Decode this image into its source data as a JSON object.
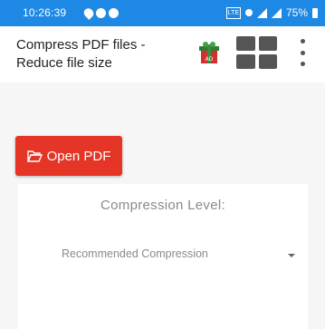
{
  "status_bar": {
    "time": "10:26:39",
    "sim_label": "LTE",
    "battery": "75%",
    "color": "#1e88e5"
  },
  "app_bar": {
    "title": "Compress PDF files - Reduce file size",
    "gift_badge": "AD",
    "icons": [
      "gift-icon",
      "grid-icon",
      "more-vert-icon"
    ]
  },
  "main": {
    "open_button_label": "Open PDF",
    "open_button_color": "#e53526",
    "compression_level_label": "Compression Level:",
    "compression_select_value": "Recommended Compression"
  }
}
